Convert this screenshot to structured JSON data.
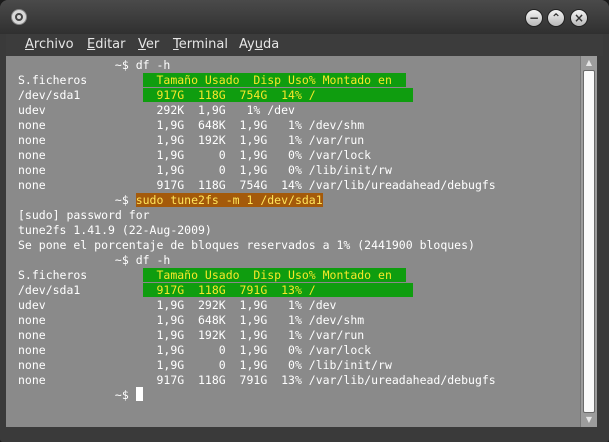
{
  "window": {
    "menus": [
      {
        "prefix": "",
        "accel": "A",
        "rest": "rchivo"
      },
      {
        "prefix": "",
        "accel": "E",
        "rest": "ditar"
      },
      {
        "prefix": "",
        "accel": "V",
        "rest": "er"
      },
      {
        "prefix": "",
        "accel": "T",
        "rest": "erminal"
      },
      {
        "prefix": "Ay",
        "accel": "u",
        "rest": "da"
      }
    ],
    "buttons": {
      "minimize": "−",
      "maximize": "⌃",
      "close": "×"
    }
  },
  "terminal": {
    "lines": [
      {
        "plain": "              ~$ df -h",
        "hl": ""
      },
      {
        "plain": "S.ficheros        ",
        "hl": "  Tamaño Usado  Disp Uso% Montado en  "
      },
      {
        "plain": "/dev/sda1         ",
        "hl": "  917G  118G  754G  14% /              "
      },
      {
        "plain": "udev                292K  1,9G   1% /dev",
        "hl": ""
      },
      {
        "plain": "none                1,9G  648K  1,9G   1% /dev/shm",
        "hl": ""
      },
      {
        "plain": "none                1,9G  192K  1,9G   1% /var/run",
        "hl": ""
      },
      {
        "plain": "none                1,9G     0  1,9G   0% /var/lock",
        "hl": ""
      },
      {
        "plain": "none                1,9G     0  1,9G   0% /lib/init/rw",
        "hl": ""
      },
      {
        "plain": "none                917G  118G  754G  14% /var/lib/ureadahead/debugfs",
        "hl": ""
      },
      {
        "plain": "              ~$ ",
        "hl_orange": "sudo tune2fs -m 1 /dev/sda1"
      },
      {
        "plain": "[sudo] password for",
        "hl": ""
      },
      {
        "plain": "tune2fs 1.41.9 (22-Aug-2009)",
        "hl": ""
      },
      {
        "plain": "Se pone el porcentaje de bloques reservados a 1% (2441900 bloques)",
        "hl": ""
      },
      {
        "plain": "              ~$ df -h",
        "hl": ""
      },
      {
        "plain": "S.ficheros        ",
        "hl": "  Tamaño Usado  Disp Uso% Montado en  "
      },
      {
        "plain": "/dev/sda1         ",
        "hl": "  917G  118G  791G  13% /              "
      },
      {
        "plain": "udev                1,9G  292K  1,9G   1% /dev",
        "hl": ""
      },
      {
        "plain": "none                1,9G  648K  1,9G   1% /dev/shm",
        "hl": ""
      },
      {
        "plain": "none                1,9G  192K  1,9G   1% /var/run",
        "hl": ""
      },
      {
        "plain": "none                1,9G     0  1,9G   0% /var/lock",
        "hl": ""
      },
      {
        "plain": "none                1,9G     0  1,9G   0% /lib/init/rw",
        "hl": ""
      },
      {
        "plain": "none                917G  118G  791G  13% /var/lib/ureadahead/debugfs",
        "hl": ""
      },
      {
        "plain": "              ~$ ",
        "hl": "",
        "cursor": true
      }
    ]
  },
  "scrollbar": {
    "up_glyph": "▲",
    "down_glyph": "▼"
  }
}
